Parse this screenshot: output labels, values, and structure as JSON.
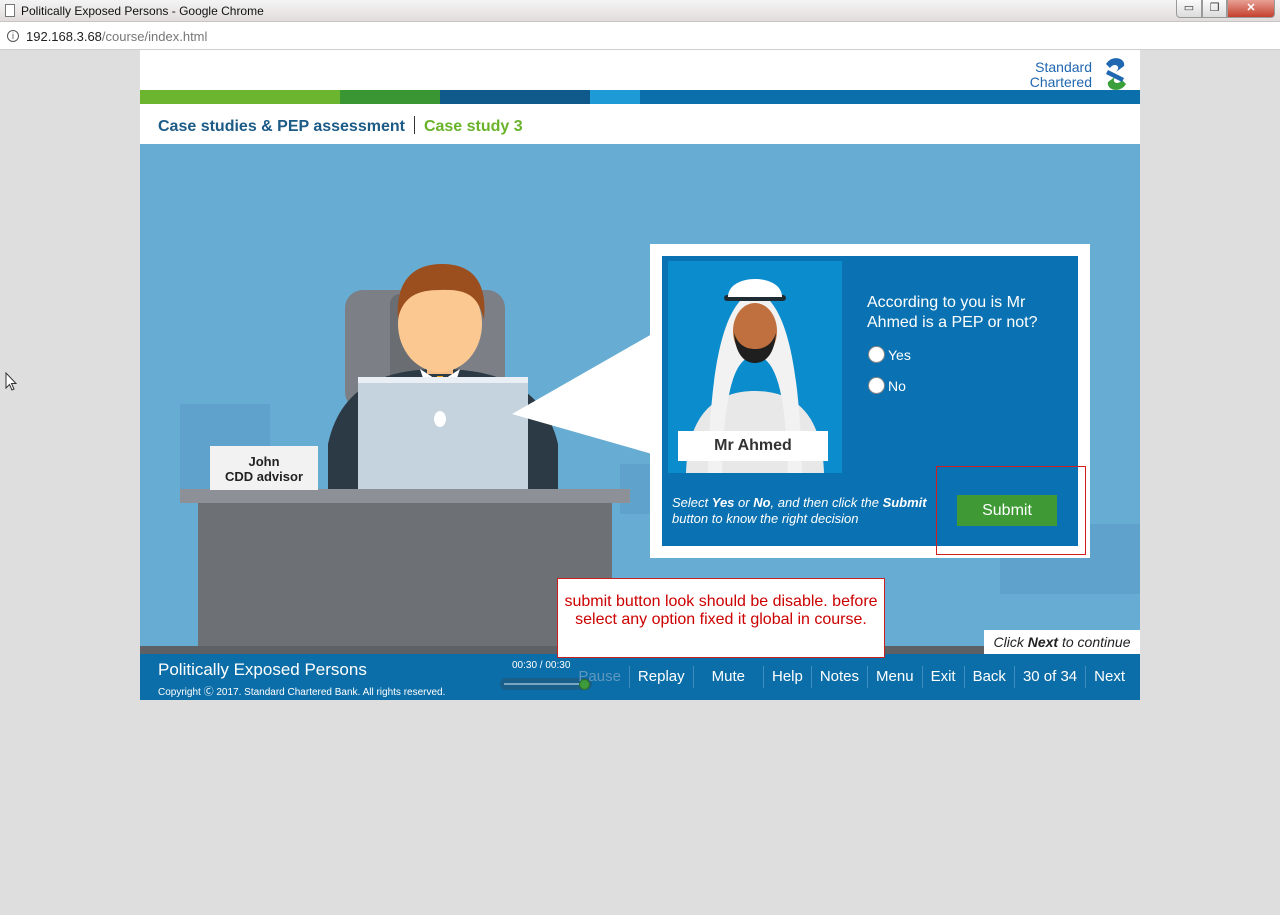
{
  "window": {
    "title": "Politically Exposed Persons - Google Chrome",
    "url_host": "192.168.3.68",
    "url_path": "/course/index.html",
    "controls": {
      "minimize": "▭",
      "maximize": "❐",
      "close": "✕"
    }
  },
  "brand": {
    "line1": "Standard",
    "line2": "Chartered",
    "colors": {
      "blue": "#1f67b0",
      "green": "#69b32a"
    }
  },
  "colorbar": [
    "#6bb62e",
    "#3a9632",
    "#0f5a8b",
    "#1e9bd7",
    "#0b6fab"
  ],
  "breadcrumb": {
    "section": "Case studies & PEP assessment",
    "page": "Case study 3"
  },
  "scene": {
    "nameplate": {
      "name": "John",
      "role": "CDD advisor"
    }
  },
  "question_panel": {
    "person_label": "Mr Ahmed",
    "question": "According to you is Mr Ahmed is a PEP or not?",
    "options": [
      "Yes",
      "No"
    ],
    "instruction_parts": [
      "Select ",
      "Yes",
      " or ",
      "No",
      ", and then click the ",
      "Submit",
      " button to know the right decision"
    ],
    "submit_label": "Submit"
  },
  "continue_hint": {
    "pre": "Click ",
    "bold": "Next",
    "post": " to continue"
  },
  "footer": {
    "course_title": "Politically Exposed Persons",
    "copyright": "Copyright Ⓒ 2017. Standard Chartered Bank. All rights reserved.",
    "timer": "00:30 / 00:30",
    "progress": 1.0,
    "nav": {
      "pause": "Pause",
      "replay": "Replay",
      "mute": "Mute",
      "help": "Help",
      "notes": "Notes",
      "menu": "Menu",
      "exit": "Exit",
      "back": "Back",
      "page_counter": "30 of 34",
      "next": "Next"
    }
  },
  "annotation": {
    "text": "submit button look should be disable. before select any option fixed it global in course."
  }
}
